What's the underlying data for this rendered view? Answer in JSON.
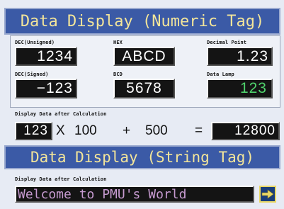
{
  "numeric_section": {
    "title": "Data Display (Numeric Tag)",
    "fields": {
      "dec_unsigned": {
        "label": "DEC(Unsigned)",
        "value": "1234"
      },
      "hex": {
        "label": "HEX",
        "value": "ABCD"
      },
      "decimal_point": {
        "label": "Decimal Point",
        "value": "1.23"
      },
      "dec_signed": {
        "label": "DEC(Signed)",
        "value": "−123"
      },
      "bcd": {
        "label": "BCD",
        "value": "5678"
      },
      "data_lamp": {
        "label": "Data Lamp",
        "value": "123"
      }
    }
  },
  "calculation": {
    "label": "Display Data after Calculation",
    "input_value": "123",
    "operator1": "X",
    "operand1": "100",
    "operator2": "+",
    "operand2": "500",
    "equals": "=",
    "result": "12800"
  },
  "string_section": {
    "title": "Data Display (String Tag)",
    "label": "Display Data after Calculation",
    "value": "Welcome to PMU's World"
  },
  "colors": {
    "banner_bg": "#3b5aa6",
    "banner_text": "#f3e59a",
    "lamp_text": "#4fd36c",
    "string_text": "#c79bd1",
    "arrow_button_border": "#e9d867"
  },
  "icons": {
    "next_button": "right-arrow-icon"
  }
}
